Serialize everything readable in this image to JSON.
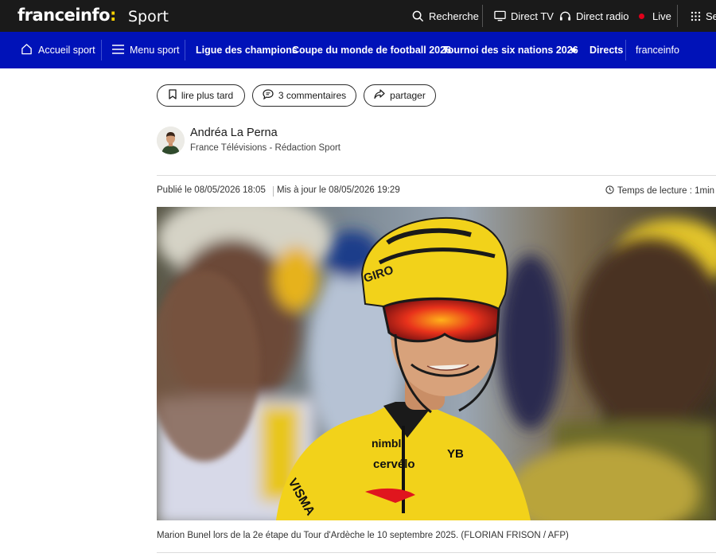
{
  "topbar": {
    "logo_text": "franceinfo",
    "logo_colon": ":",
    "section": "Sport",
    "items": [
      {
        "label": "Recherche",
        "icon": "search-icon"
      },
      {
        "label": "Direct TV",
        "icon": "tv-icon"
      },
      {
        "label": "Direct radio",
        "icon": "headphones-icon"
      },
      {
        "label": "Live",
        "icon": "live-dot-icon"
      },
      {
        "label": "Se",
        "icon": "grid-icon"
      }
    ]
  },
  "nav": {
    "home_label": "Accueil sport",
    "menu_label": "Menu sport",
    "links": [
      "Ligue des champions",
      "Coupe du monde de football 2026",
      "Tournoi des six nations 2026"
    ],
    "directs_label": "Directs",
    "franceinfo_label": "franceinfo"
  },
  "actions": {
    "read_later": "lire plus tard",
    "comments": "3 commentaires",
    "share": "partager"
  },
  "author": {
    "name": "Andréa La Perna",
    "organization": "France Télévisions - Rédaction Sport"
  },
  "meta": {
    "published": "Publié le 08/05/2026 18:05",
    "updated": "Mis à jour le 08/05/2026 19:29",
    "reading_time": "Temps de lecture : 1min"
  },
  "photo": {
    "helmet_brand": "GIRO",
    "jersey_texts": [
      "VISMA",
      "nimbl",
      "cervélo",
      "YB"
    ],
    "caption": "Marion Bunel lors de la 2e étape du Tour d'Ardèche le 10 septembre 2025. (FLORIAN FRISON / AFP)"
  },
  "colors": {
    "topbar_bg": "#1a1a1a",
    "nav_bg": "#0012b8",
    "logo_accent": "#ffd200",
    "live_dot": "#e0001a",
    "jersey_yellow": "#f2d21a"
  }
}
